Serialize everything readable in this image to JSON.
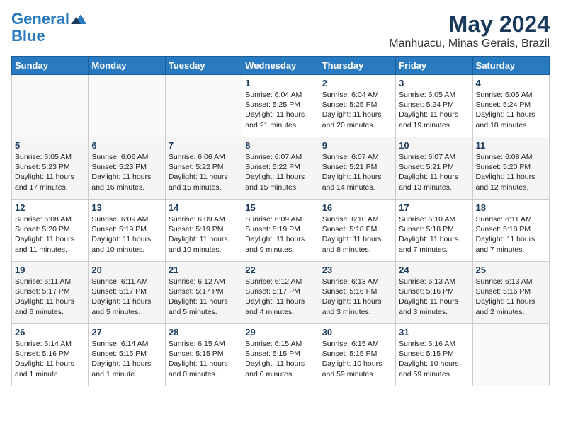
{
  "logo": {
    "line1": "General",
    "line2": "Blue"
  },
  "title": "May 2024",
  "subtitle": "Manhuacu, Minas Gerais, Brazil",
  "headers": [
    "Sunday",
    "Monday",
    "Tuesday",
    "Wednesday",
    "Thursday",
    "Friday",
    "Saturday"
  ],
  "weeks": [
    [
      {
        "day": "",
        "text": ""
      },
      {
        "day": "",
        "text": ""
      },
      {
        "day": "",
        "text": ""
      },
      {
        "day": "1",
        "text": "Sunrise: 6:04 AM\nSunset: 5:25 PM\nDaylight: 11 hours and 21 minutes."
      },
      {
        "day": "2",
        "text": "Sunrise: 6:04 AM\nSunset: 5:25 PM\nDaylight: 11 hours and 20 minutes."
      },
      {
        "day": "3",
        "text": "Sunrise: 6:05 AM\nSunset: 5:24 PM\nDaylight: 11 hours and 19 minutes."
      },
      {
        "day": "4",
        "text": "Sunrise: 6:05 AM\nSunset: 5:24 PM\nDaylight: 11 hours and 18 minutes."
      }
    ],
    [
      {
        "day": "5",
        "text": "Sunrise: 6:05 AM\nSunset: 5:23 PM\nDaylight: 11 hours and 17 minutes."
      },
      {
        "day": "6",
        "text": "Sunrise: 6:06 AM\nSunset: 5:23 PM\nDaylight: 11 hours and 16 minutes."
      },
      {
        "day": "7",
        "text": "Sunrise: 6:06 AM\nSunset: 5:22 PM\nDaylight: 11 hours and 15 minutes."
      },
      {
        "day": "8",
        "text": "Sunrise: 6:07 AM\nSunset: 5:22 PM\nDaylight: 11 hours and 15 minutes."
      },
      {
        "day": "9",
        "text": "Sunrise: 6:07 AM\nSunset: 5:21 PM\nDaylight: 11 hours and 14 minutes."
      },
      {
        "day": "10",
        "text": "Sunrise: 6:07 AM\nSunset: 5:21 PM\nDaylight: 11 hours and 13 minutes."
      },
      {
        "day": "11",
        "text": "Sunrise: 6:08 AM\nSunset: 5:20 PM\nDaylight: 11 hours and 12 minutes."
      }
    ],
    [
      {
        "day": "12",
        "text": "Sunrise: 6:08 AM\nSunset: 5:20 PM\nDaylight: 11 hours and 11 minutes."
      },
      {
        "day": "13",
        "text": "Sunrise: 6:09 AM\nSunset: 5:19 PM\nDaylight: 11 hours and 10 minutes."
      },
      {
        "day": "14",
        "text": "Sunrise: 6:09 AM\nSunset: 5:19 PM\nDaylight: 11 hours and 10 minutes."
      },
      {
        "day": "15",
        "text": "Sunrise: 6:09 AM\nSunset: 5:19 PM\nDaylight: 11 hours and 9 minutes."
      },
      {
        "day": "16",
        "text": "Sunrise: 6:10 AM\nSunset: 5:18 PM\nDaylight: 11 hours and 8 minutes."
      },
      {
        "day": "17",
        "text": "Sunrise: 6:10 AM\nSunset: 5:18 PM\nDaylight: 11 hours and 7 minutes."
      },
      {
        "day": "18",
        "text": "Sunrise: 6:11 AM\nSunset: 5:18 PM\nDaylight: 11 hours and 7 minutes."
      }
    ],
    [
      {
        "day": "19",
        "text": "Sunrise: 6:11 AM\nSunset: 5:17 PM\nDaylight: 11 hours and 6 minutes."
      },
      {
        "day": "20",
        "text": "Sunrise: 6:11 AM\nSunset: 5:17 PM\nDaylight: 11 hours and 5 minutes."
      },
      {
        "day": "21",
        "text": "Sunrise: 6:12 AM\nSunset: 5:17 PM\nDaylight: 11 hours and 5 minutes."
      },
      {
        "day": "22",
        "text": "Sunrise: 6:12 AM\nSunset: 5:17 PM\nDaylight: 11 hours and 4 minutes."
      },
      {
        "day": "23",
        "text": "Sunrise: 6:13 AM\nSunset: 5:16 PM\nDaylight: 11 hours and 3 minutes."
      },
      {
        "day": "24",
        "text": "Sunrise: 6:13 AM\nSunset: 5:16 PM\nDaylight: 11 hours and 3 minutes."
      },
      {
        "day": "25",
        "text": "Sunrise: 6:13 AM\nSunset: 5:16 PM\nDaylight: 11 hours and 2 minutes."
      }
    ],
    [
      {
        "day": "26",
        "text": "Sunrise: 6:14 AM\nSunset: 5:16 PM\nDaylight: 11 hours and 1 minute."
      },
      {
        "day": "27",
        "text": "Sunrise: 6:14 AM\nSunset: 5:15 PM\nDaylight: 11 hours and 1 minute."
      },
      {
        "day": "28",
        "text": "Sunrise: 6:15 AM\nSunset: 5:15 PM\nDaylight: 11 hours and 0 minutes."
      },
      {
        "day": "29",
        "text": "Sunrise: 6:15 AM\nSunset: 5:15 PM\nDaylight: 11 hours and 0 minutes."
      },
      {
        "day": "30",
        "text": "Sunrise: 6:15 AM\nSunset: 5:15 PM\nDaylight: 10 hours and 59 minutes."
      },
      {
        "day": "31",
        "text": "Sunrise: 6:16 AM\nSunset: 5:15 PM\nDaylight: 10 hours and 59 minutes."
      },
      {
        "day": "",
        "text": ""
      }
    ]
  ]
}
